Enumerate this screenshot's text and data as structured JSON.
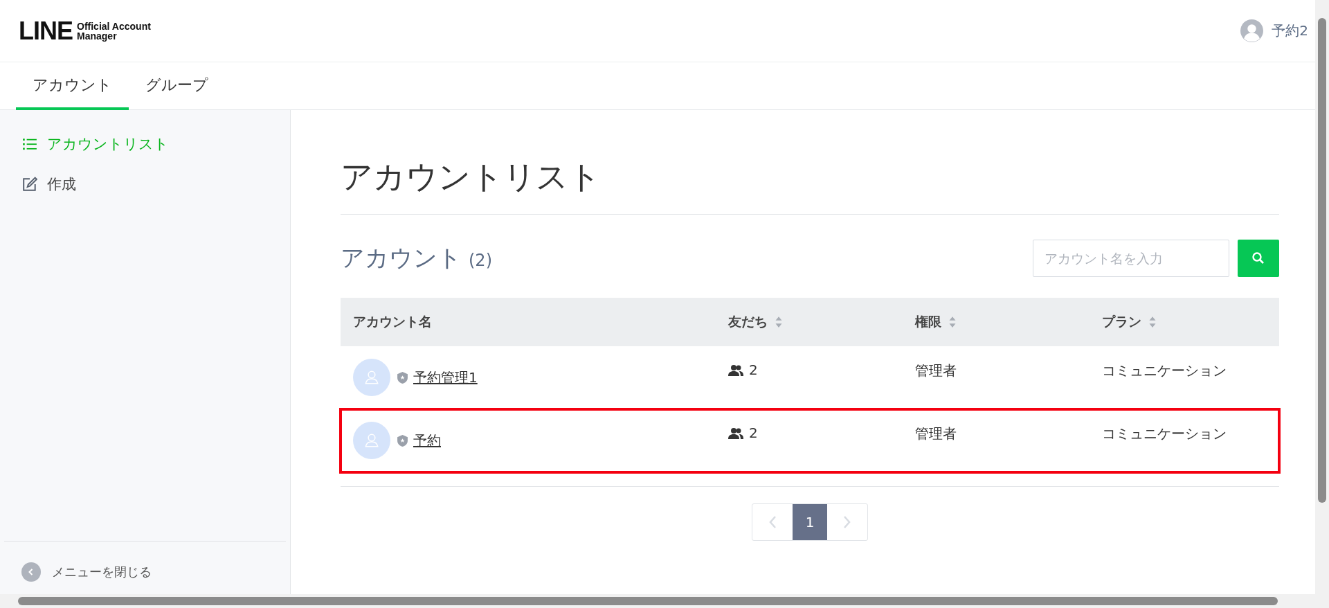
{
  "header": {
    "logo_mark": "LINE",
    "logo_text": [
      "Official Account",
      "Manager"
    ],
    "user": "予約2"
  },
  "tabs": [
    {
      "label": "アカウント",
      "selected": true
    },
    {
      "label": "グループ",
      "selected": false
    }
  ],
  "sidebar": {
    "items": [
      {
        "label": "アカウントリスト",
        "kind": "list",
        "selected": true
      },
      {
        "label": "作成",
        "kind": "edit",
        "selected": false
      }
    ],
    "close_menu": "メニューを閉じる"
  },
  "page_title": "アカウントリスト",
  "section": {
    "title": "アカウント",
    "count": "(2)",
    "search": {
      "placeholder": "アカウント名を入力"
    }
  },
  "table": {
    "columns": [
      {
        "label": "アカウント名",
        "sortable": false
      },
      {
        "label": "友だち",
        "sortable": true
      },
      {
        "label": "権限",
        "sortable": true
      },
      {
        "label": "プラン",
        "sortable": true
      }
    ],
    "rows": [
      {
        "name": "予約管理1",
        "friends": "2",
        "role": "管理者",
        "plan": "コミュニケーション",
        "highlighted": false
      },
      {
        "name": "予約",
        "friends": "2",
        "role": "管理者",
        "plan": "コミュニケーション",
        "highlighted": true
      }
    ]
  },
  "pagination": {
    "pages": [
      {
        "label": "1",
        "selected": true
      }
    ]
  }
}
